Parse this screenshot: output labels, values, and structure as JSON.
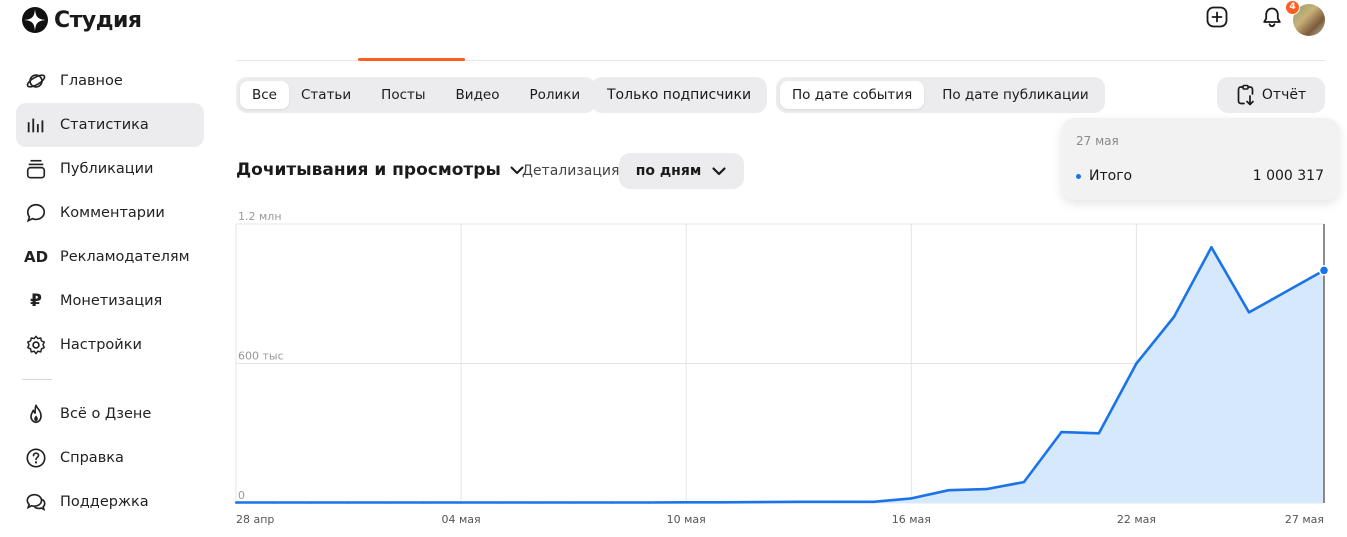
{
  "app": {
    "title": "Студия"
  },
  "sidebar": {
    "items": [
      {
        "label": "Главное",
        "icon": "planet-icon"
      },
      {
        "label": "Статистика",
        "icon": "bar-chart-icon",
        "active": true
      },
      {
        "label": "Публикации",
        "icon": "stack-icon"
      },
      {
        "label": "Комментарии",
        "icon": "comment-icon"
      },
      {
        "label": "Рекламодателям",
        "icon": "ad-icon",
        "icon_text": "AD"
      },
      {
        "label": "Монетизация",
        "icon": "ruble-icon",
        "icon_text": "₽"
      },
      {
        "label": "Настройки",
        "icon": "gear-icon"
      }
    ],
    "secondary": [
      {
        "label": "Всё о Дзене",
        "icon": "flame-icon"
      },
      {
        "label": "Справка",
        "icon": "help-icon"
      },
      {
        "label": "Поддержка",
        "icon": "support-icon"
      }
    ]
  },
  "header": {
    "notifications_count": "4"
  },
  "filters": {
    "content_types": [
      "Все",
      "Статьи",
      "Посты",
      "Видео",
      "Ролики"
    ],
    "content_selected": "Все",
    "subscribers_only": "Только подписчики",
    "date_modes": [
      "По дате события",
      "По дате публикации"
    ],
    "date_selected": "По дате события",
    "report_label": "Отчёт"
  },
  "metric": {
    "title": "Дочитывания и просмотры",
    "detail_label": "Детализация",
    "detail_value": "по дням"
  },
  "tooltip": {
    "date": "27 мая",
    "label": "Итого",
    "value": "1 000 317"
  },
  "colors": {
    "accent": "#ff5e1f",
    "series": "#1a73e8",
    "fill": "#d6e8fb"
  },
  "chart_data": {
    "type": "area",
    "x": [
      "28 апр",
      "29 апр",
      "30 апр",
      "1 мая",
      "2 мая",
      "3 мая",
      "04 мая",
      "5 мая",
      "6 мая",
      "7 мая",
      "8 мая",
      "9 мая",
      "10 мая",
      "11 мая",
      "12 мая",
      "13 мая",
      "14 мая",
      "15 мая",
      "16 мая",
      "17 мая",
      "18 мая",
      "19 мая",
      "20 мая",
      "21 мая",
      "22 мая",
      "23 мая",
      "24 мая",
      "25 мая",
      "26 мая",
      "27 мая"
    ],
    "x_tick_labels": [
      {
        "index": 0,
        "label": "28 апр"
      },
      {
        "index": 6,
        "label": "04 мая"
      },
      {
        "index": 12,
        "label": "10 мая"
      },
      {
        "index": 18,
        "label": "16 мая"
      },
      {
        "index": 24,
        "label": "22 мая"
      },
      {
        "index": 29,
        "label": "27 мая"
      }
    ],
    "series": [
      {
        "values": [
          2000,
          2000,
          2000,
          2000,
          2000,
          2000,
          2000,
          2000,
          2000,
          2000,
          2000,
          2000,
          3000,
          3000,
          4000,
          5000,
          5000,
          5000,
          20000,
          55000,
          60000,
          90000,
          305000,
          300000,
          600000,
          800000,
          1100000,
          820000,
          910000,
          1000317
        ]
      }
    ],
    "y_ticks": [
      {
        "value": 0,
        "label": "0"
      },
      {
        "value": 600000,
        "label": "600 тыс"
      },
      {
        "value": 1200000,
        "label": "1.2 млн"
      }
    ],
    "ylim": [
      0,
      1200000
    ],
    "grid": true
  }
}
